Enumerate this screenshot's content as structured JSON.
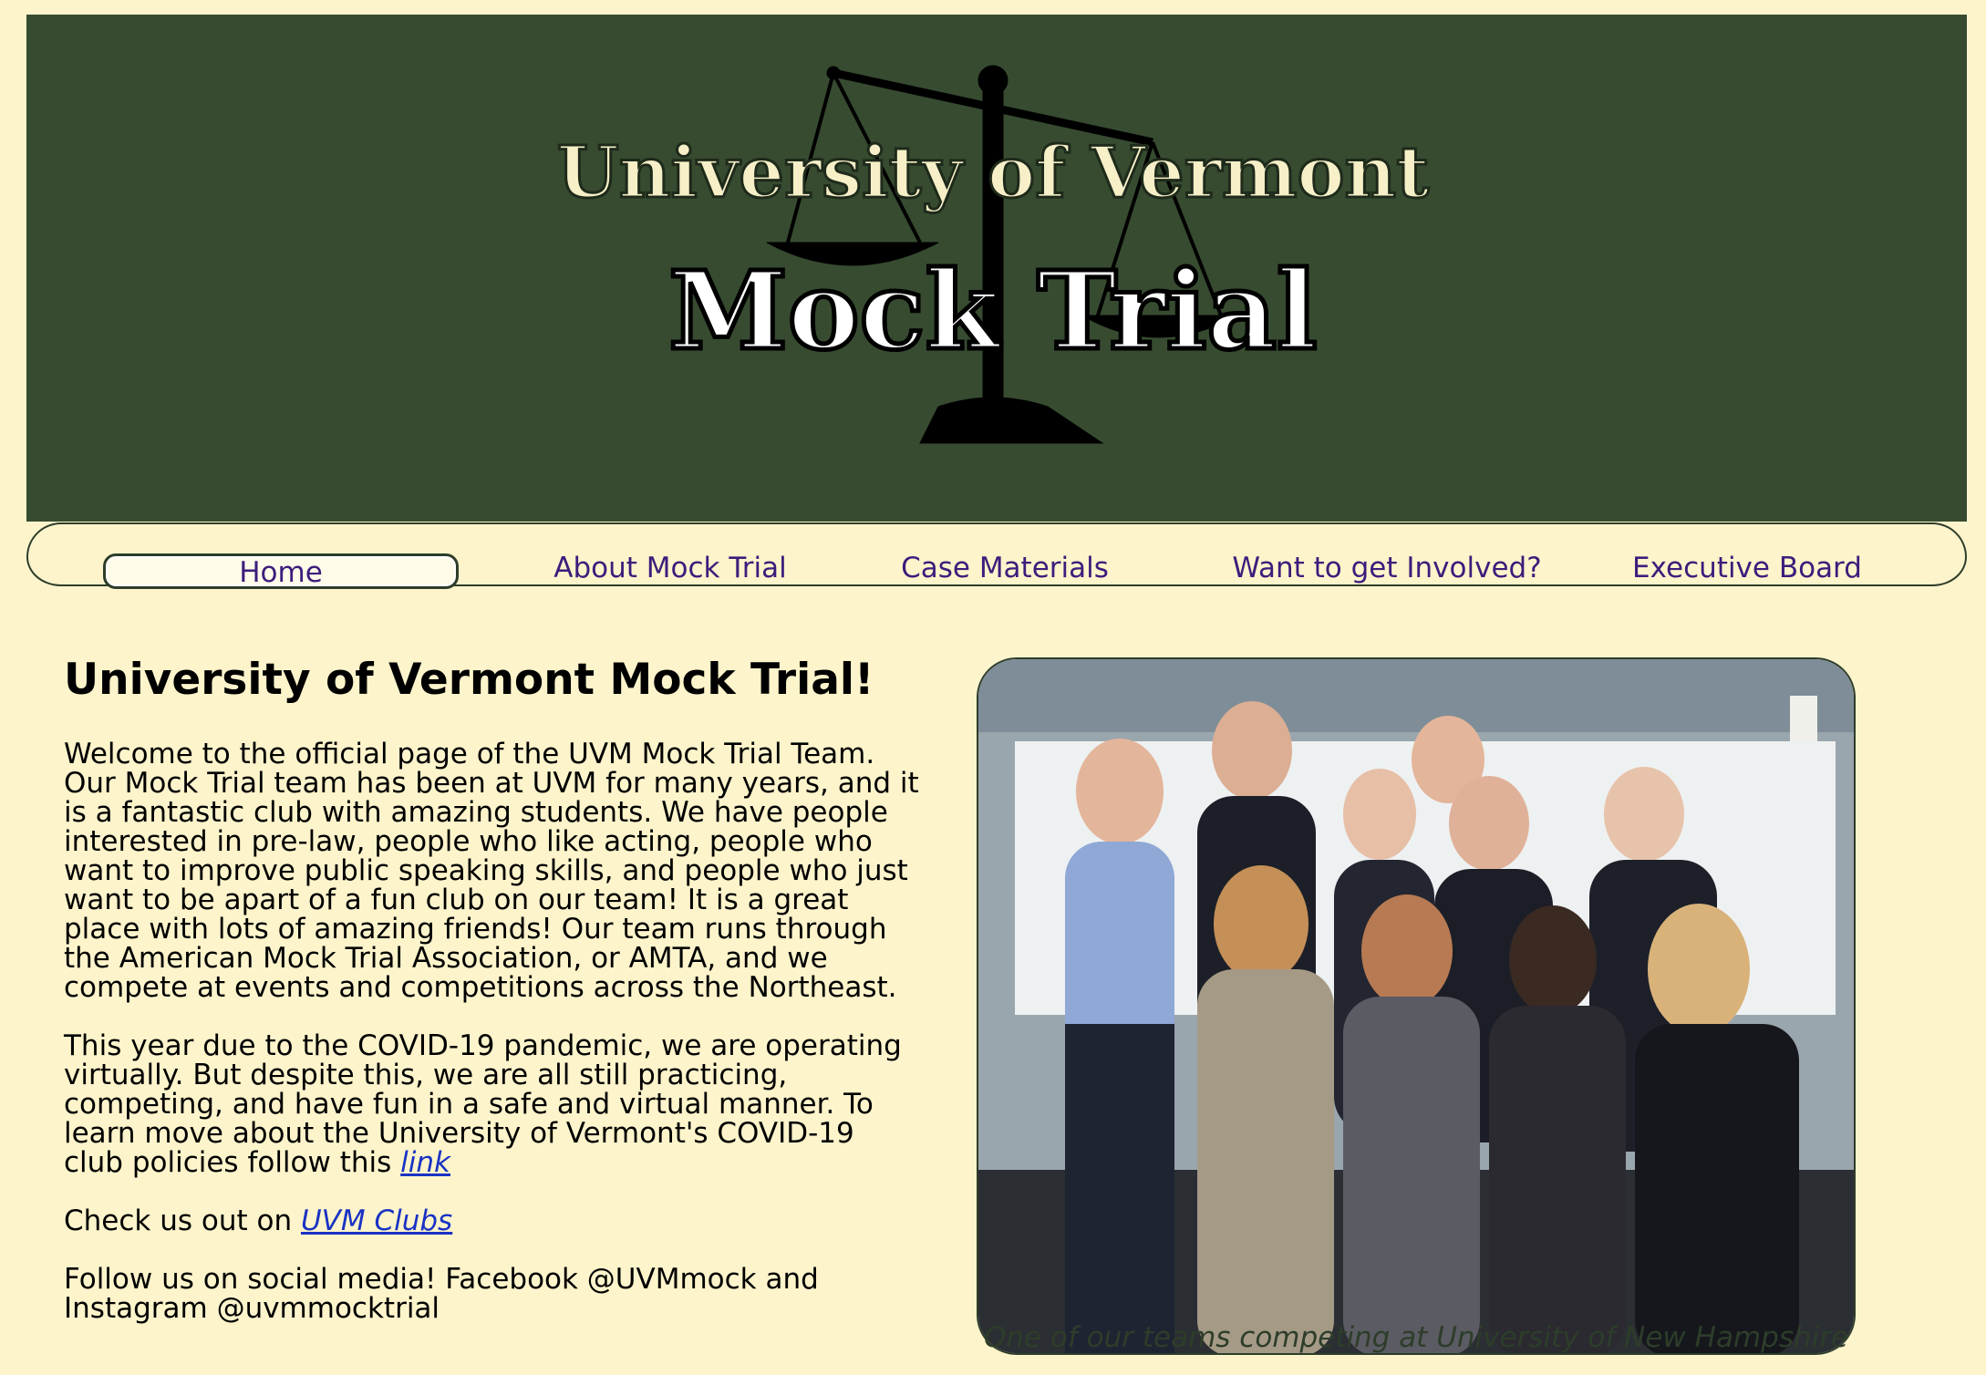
{
  "banner": {
    "line1": "University of Vermont",
    "line2": "Mock Trial"
  },
  "nav": {
    "items": [
      {
        "label": "Home",
        "active": true
      },
      {
        "label": "About Mock Trial"
      },
      {
        "label": "Case Materials"
      },
      {
        "label": "Want to get Involved?"
      },
      {
        "label": "Executive Board"
      }
    ]
  },
  "main": {
    "title": "University of Vermont Mock Trial!",
    "intro": "Welcome to the official page of the UVM Mock Trial Team. Our Mock Trial team has been at UVM for many years, and it is a fantastic club with amazing students. We have people interested in pre-law, people who like acting, people who want to improve public speaking skills, and people who just want to be apart of a fun club on our team! It is a great place with lots of amazing friends! Our team runs through the American Mock Trial Association, or AMTA, and we compete at events and competitions across the Northeast.",
    "covid_text": "This year due to the COVID-19 pandemic, we are operating virtually. But despite this, we are all still practicing, competing, and have fun in a safe and virtual manner. To learn move about the University of Vermont's COVID-19 club policies follow this",
    "covid_link": "link",
    "clubs_prefix": "Check us out on",
    "clubs_link": "UVM Clubs",
    "social": "Follow us on social media! Facebook @UVMmock and Instagram @uvmmocktrial"
  },
  "photo": {
    "caption": "One of our teams competing at University of New Hampshire"
  },
  "colors": {
    "page_bg": "#fdf4cb",
    "banner_bg": "#374b31",
    "nav_link": "#3c1d7c",
    "link": "#1a32c4"
  }
}
